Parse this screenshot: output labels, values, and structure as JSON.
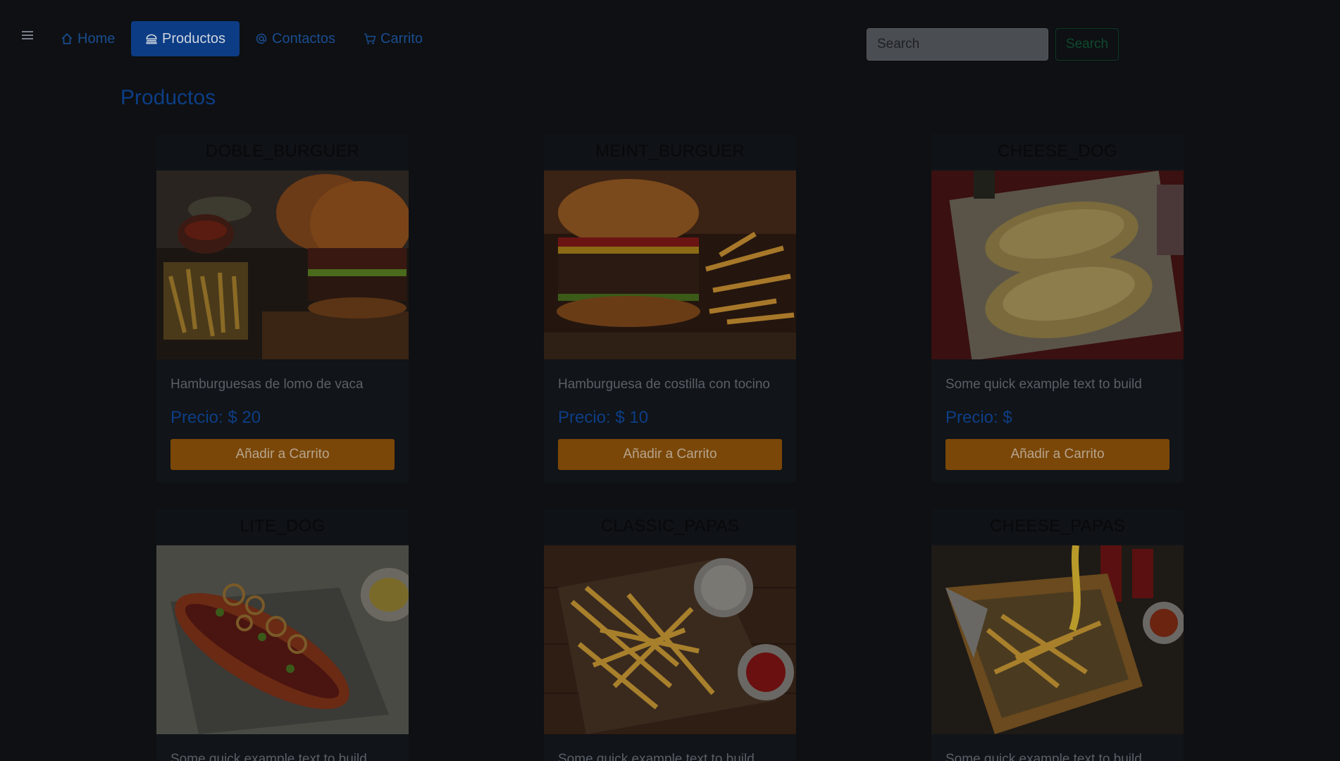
{
  "nav": {
    "items": [
      {
        "label": "Home",
        "icon": "home-icon"
      },
      {
        "label": "Productos",
        "icon": "burger-icon",
        "active": true
      },
      {
        "label": "Contactos",
        "icon": "at-icon"
      },
      {
        "label": "Carrito",
        "icon": "cart-icon"
      }
    ]
  },
  "search": {
    "placeholder": "Search",
    "button_label": "Search"
  },
  "page": {
    "title": "Productos"
  },
  "products": [
    {
      "name": "DOBLE_BURGUER",
      "description": "Hamburguesas de lomo de vaca",
      "price": "Precio: $ 20",
      "button": "Añadir a Carrito",
      "image": "double-burger-photo"
    },
    {
      "name": "MEINT_BURGUER",
      "description": "Hamburguesa de costilla con tocino",
      "price": "Precio: $ 10",
      "button": "Añadir a Carrito",
      "image": "burger-fries-photo"
    },
    {
      "name": "CHEESE_DOG",
      "description": "Some quick example text to build",
      "price": "Precio: $",
      "button": "Añadir a Carrito",
      "image": "cheese-hotdog-photo"
    },
    {
      "name": "LITE_DOG",
      "description": "Some quick example text to build",
      "price": "",
      "button": "",
      "image": "hotdog-photo"
    },
    {
      "name": "CLASSIC_PAPAS",
      "description": "Some quick example text to build",
      "price": "",
      "button": "",
      "image": "fries-photo"
    },
    {
      "name": "CHEESE_PAPAS",
      "description": "Some quick example text to build",
      "price": "",
      "button": "",
      "image": "cheese-fries-photo"
    }
  ]
}
